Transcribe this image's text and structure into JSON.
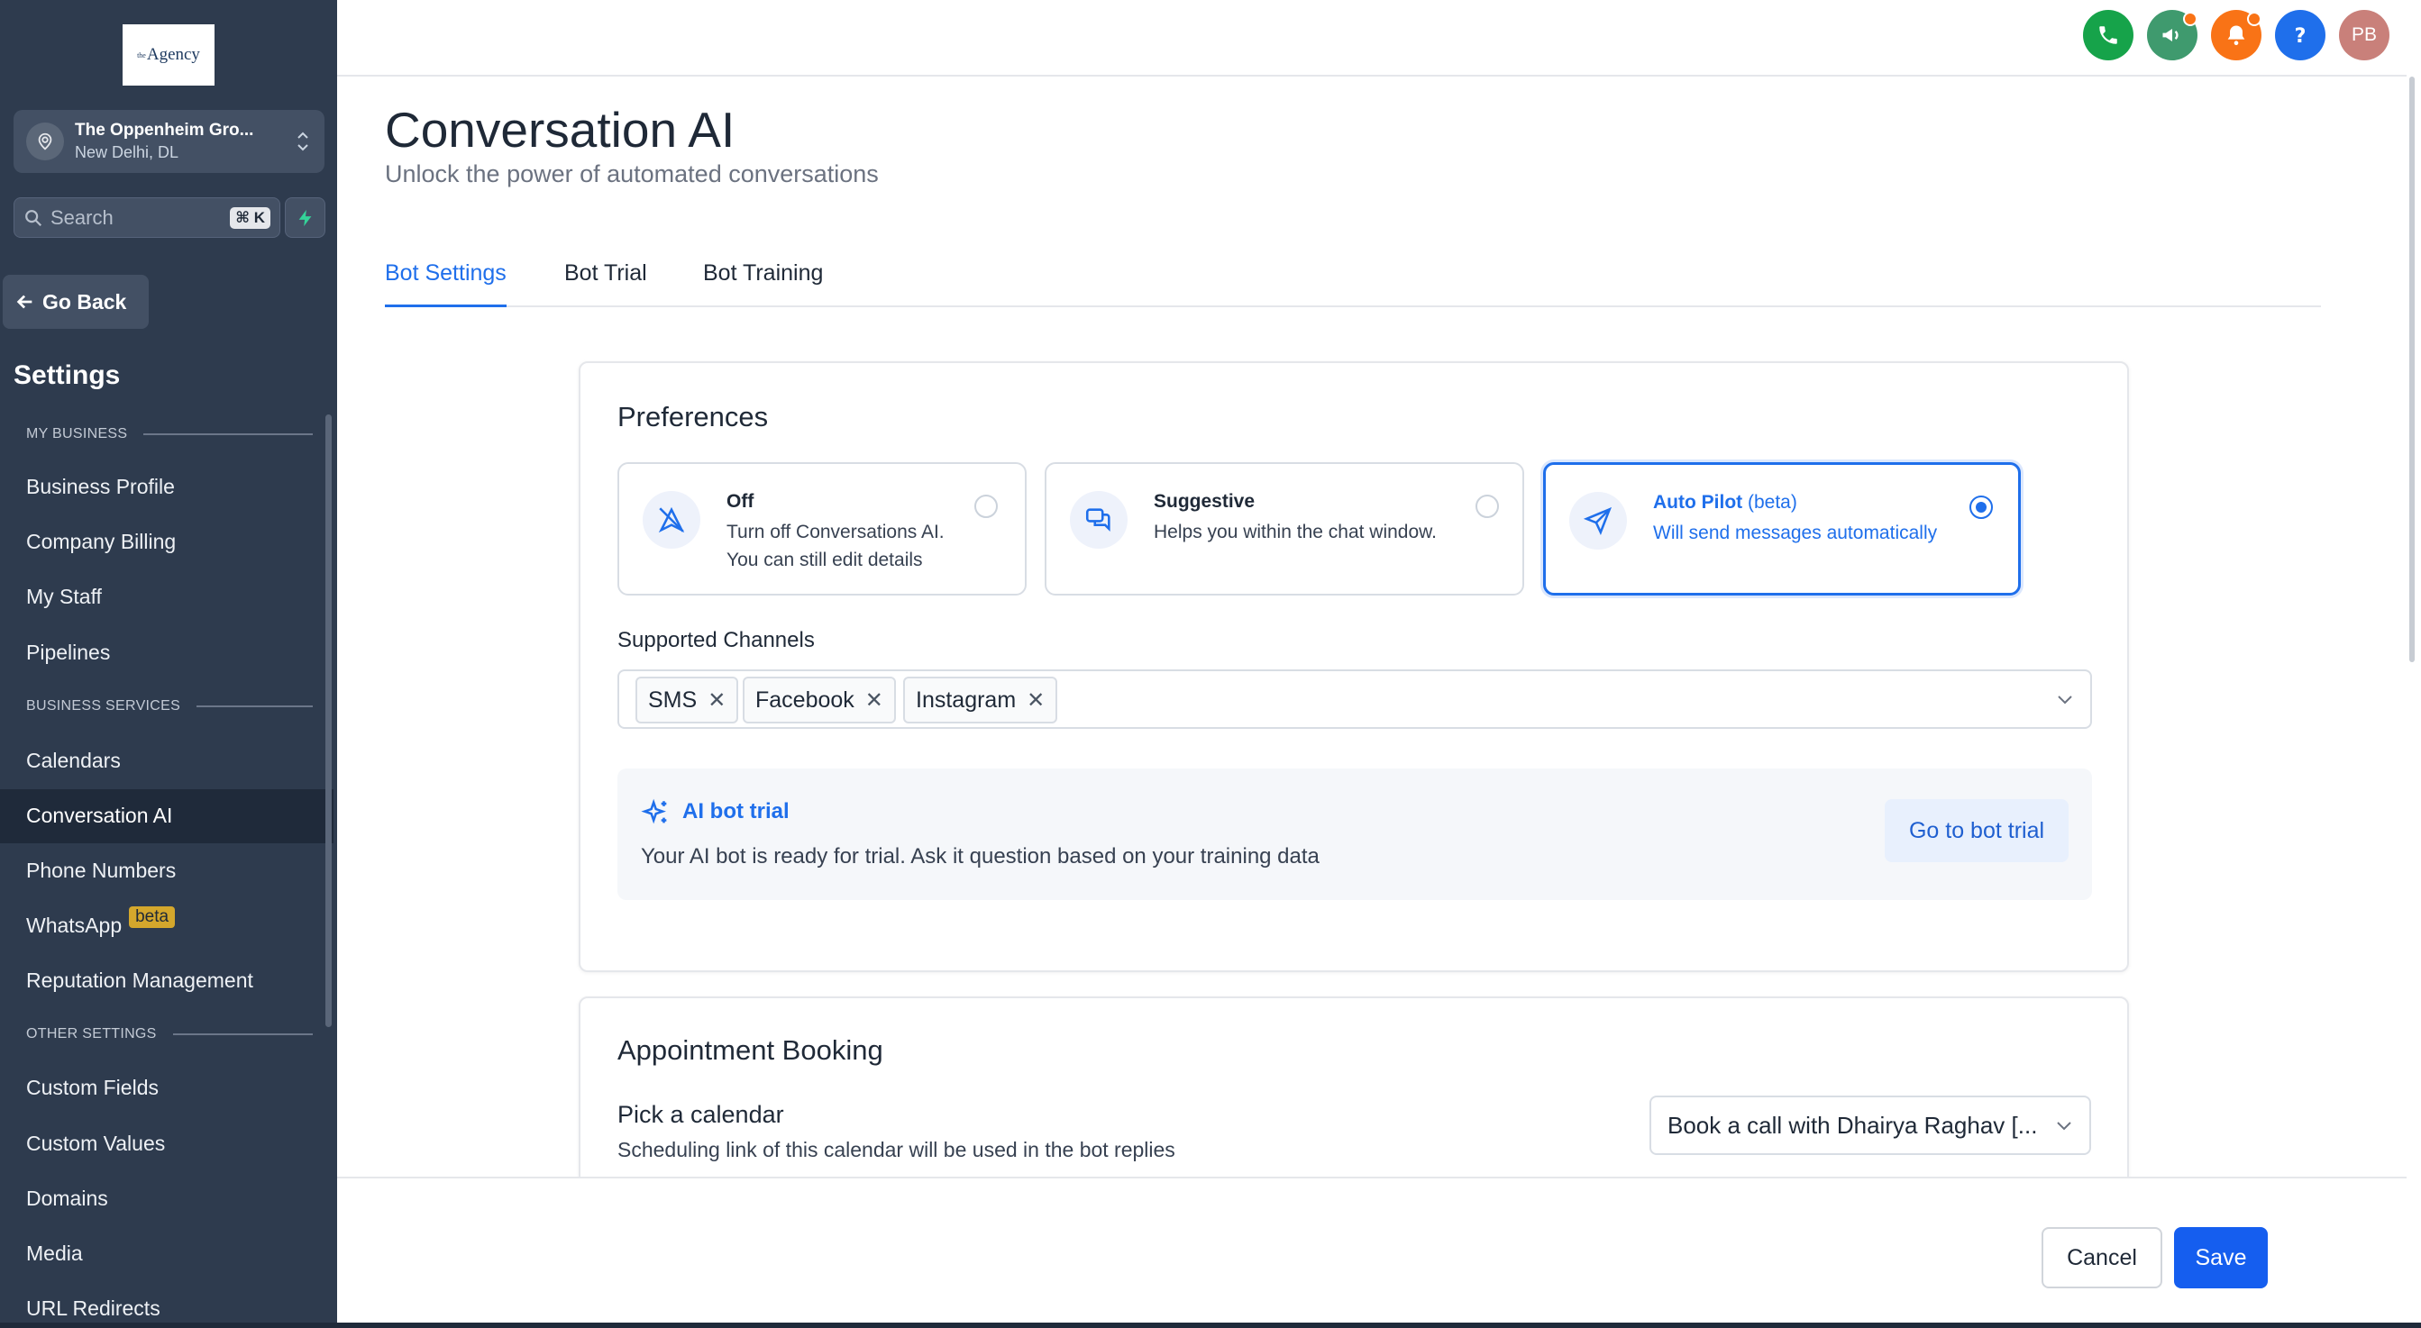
{
  "sidebar": {
    "logo": {
      "prefix": "the",
      "name": "Agency"
    },
    "location": {
      "name": "The Oppenheim Gro...",
      "subtitle": "New Delhi, DL"
    },
    "search": {
      "placeholder": "Search",
      "shortcut": "⌘ K"
    },
    "go_back": "Go Back",
    "title": "Settings",
    "sections": {
      "my_business": "MY BUSINESS",
      "business_services": "BUSINESS SERVICES",
      "other_settings": "OTHER SETTINGS"
    },
    "items": {
      "business_profile": "Business Profile",
      "company_billing": "Company Billing",
      "my_staff": "My Staff",
      "pipelines": "Pipelines",
      "calendars": "Calendars",
      "conversation_ai": "Conversation AI",
      "phone_numbers": "Phone Numbers",
      "whatsapp": "WhatsApp",
      "whatsapp_badge": "beta",
      "reputation_management": "Reputation Management",
      "custom_fields": "Custom Fields",
      "custom_values": "Custom Values",
      "domains": "Domains",
      "media": "Media",
      "url_redirects": "URL Redirects"
    },
    "active_item": "Conversation AI"
  },
  "topbar": {
    "icons": [
      "phone-icon",
      "megaphone-icon",
      "bell-icon",
      "help-icon"
    ],
    "avatar_initials": "PB",
    "colors": {
      "phone": "#16a34a",
      "megaphone": "#3f9a6e",
      "bell": "#f97316",
      "help": "#1f6feb",
      "avatar": "#c9807a"
    }
  },
  "page": {
    "title": "Conversation AI",
    "subtitle": "Unlock the power of automated conversations",
    "tabs": [
      "Bot Settings",
      "Bot Trial",
      "Bot Training"
    ],
    "active_tab": "Bot Settings"
  },
  "preferences": {
    "title": "Preferences",
    "options": [
      {
        "title": "Off",
        "badge": "",
        "desc": "Turn off Conversations AI. You can still edit details",
        "icon": "bot-off-icon",
        "selected": false
      },
      {
        "title": "Suggestive",
        "badge": "",
        "desc": "Helps you within the chat window.",
        "icon": "chat-bubbles-icon",
        "selected": false
      },
      {
        "title": "Auto Pilot",
        "badge": "(beta)",
        "desc": "Will send messages automatically",
        "icon": "send-icon",
        "selected": true
      }
    ],
    "channels_label": "Supported Channels",
    "channels": [
      "SMS",
      "Facebook",
      "Instagram"
    ],
    "trial": {
      "title": "AI bot trial",
      "desc": "Your AI bot is ready for trial. Ask it question based on your training data",
      "button": "Go to bot trial"
    }
  },
  "appointment": {
    "title": "Appointment Booking",
    "pick_label": "Pick a calendar",
    "pick_desc": "Scheduling link of this calendar will be used in the bot replies",
    "calendar_value": "Book a call with Dhairya Raghav [..."
  },
  "footer": {
    "cancel": "Cancel",
    "save": "Save"
  },
  "colors": {
    "accent": "#1f6feb",
    "sidebar_bg": "#2e3b4e",
    "beta_badge": "#d4a72c"
  }
}
